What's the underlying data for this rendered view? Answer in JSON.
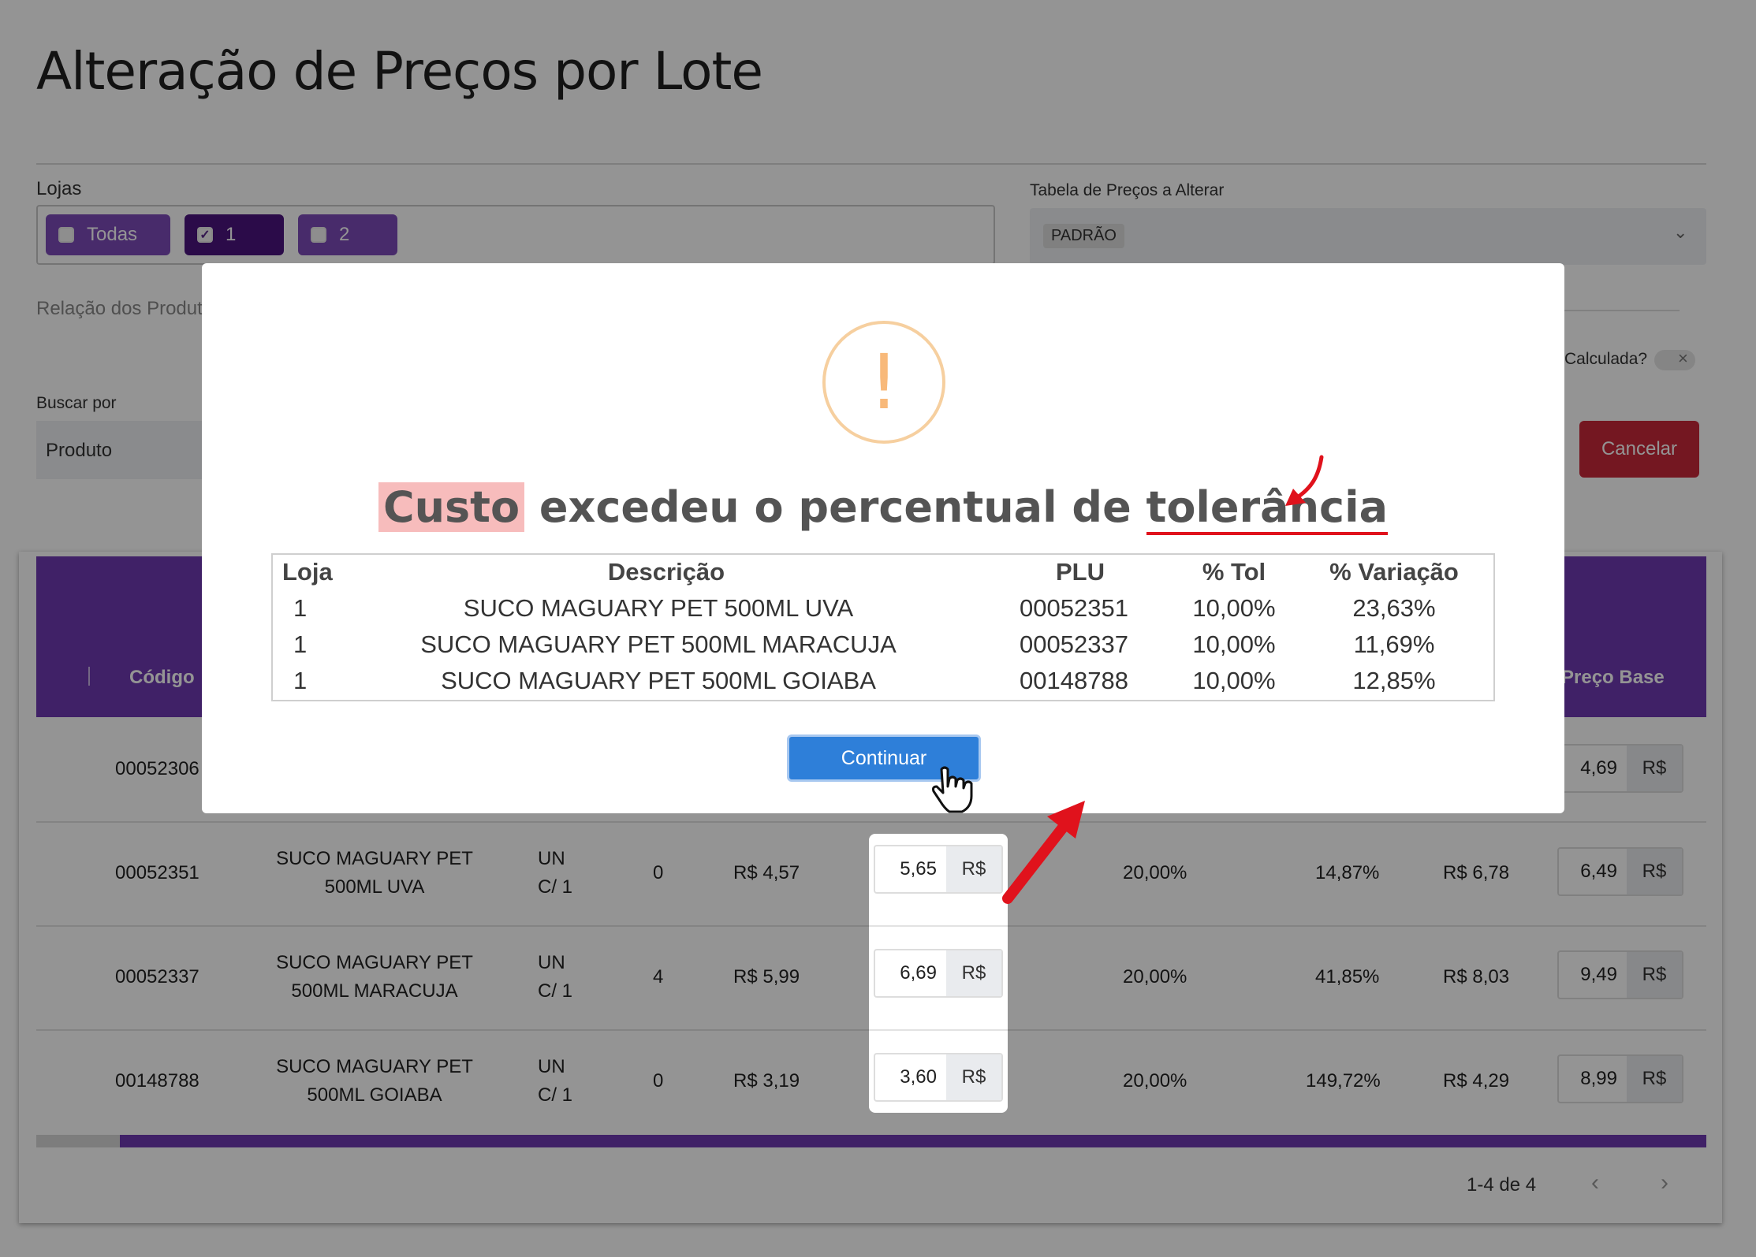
{
  "page": {
    "title": "Alteração de Preços por Lote",
    "stores_label": "Lojas",
    "stores": [
      {
        "label": "Todas",
        "checked": false
      },
      {
        "label": "1",
        "checked": true
      },
      {
        "label": "2",
        "checked": false
      }
    ],
    "price_table_label": "Tabela de Preços a Alterar",
    "price_table_value": "PADRÃO",
    "products_relation_label": "Relação dos Produt",
    "calculated_label": "Calculada?",
    "search_by_label": "Buscar por",
    "search_by_value": "Produto",
    "cancel_button": "Cancelar"
  },
  "table": {
    "headers": {
      "code": "Código",
      "base_price": "Preço Base"
    },
    "first_row_code": "00052306",
    "first_row_base": "4,69",
    "currency": "R$",
    "rows": [
      {
        "code": "00052351",
        "desc1": "SUCO MAGUARY PET",
        "desc2": "500ML UVA",
        "unit1": "UN",
        "unit2": "C/ 1",
        "stock": "0",
        "cost": "R$ 4,57",
        "new_cost": "5,65",
        "margin": "20,00%",
        "variation": "14,87%",
        "suggested": "R$ 6,78",
        "base": "6,49"
      },
      {
        "code": "00052337",
        "desc1": "SUCO MAGUARY PET",
        "desc2": "500ML MARACUJA",
        "unit1": "UN",
        "unit2": "C/ 1",
        "stock": "4",
        "cost": "R$ 5,99",
        "new_cost": "6,69",
        "margin": "20,00%",
        "variation": "41,85%",
        "suggested": "R$ 8,03",
        "base": "9,49"
      },
      {
        "code": "00148788",
        "desc1": "SUCO MAGUARY PET",
        "desc2": "500ML GOIABA",
        "unit1": "UN",
        "unit2": "C/ 1",
        "stock": "0",
        "cost": "R$ 3,19",
        "new_cost": "3,60",
        "margin": "20,00%",
        "variation": "149,72%",
        "suggested": "R$ 4,29",
        "base": "8,99"
      }
    ],
    "pagination": "1-4 de 4"
  },
  "modal": {
    "icon": "exclamation-icon",
    "title_highlight": "Custo",
    "title_middle": " excedeu o percentual de ",
    "title_underlined": "tolerância",
    "columns": [
      "Loja",
      "Descrição",
      "PLU",
      "% Tol",
      "% Variação"
    ],
    "rows": [
      [
        "1",
        "SUCO MAGUARY PET 500ML UVA",
        "00052351",
        "10,00%",
        "23,63%"
      ],
      [
        "1",
        "SUCO MAGUARY PET 500ML MARACUJA",
        "00052337",
        "10,00%",
        "11,69%"
      ],
      [
        "1",
        "SUCO MAGUARY PET 500ML GOIABA",
        "00148788",
        "10,00%",
        "12,85%"
      ]
    ],
    "continue_button": "Continuar"
  },
  "colors": {
    "purple": "#6f3ab1",
    "cancel": "#c8293a",
    "continue": "#2e7fd9",
    "annotation": "#e0121c"
  }
}
